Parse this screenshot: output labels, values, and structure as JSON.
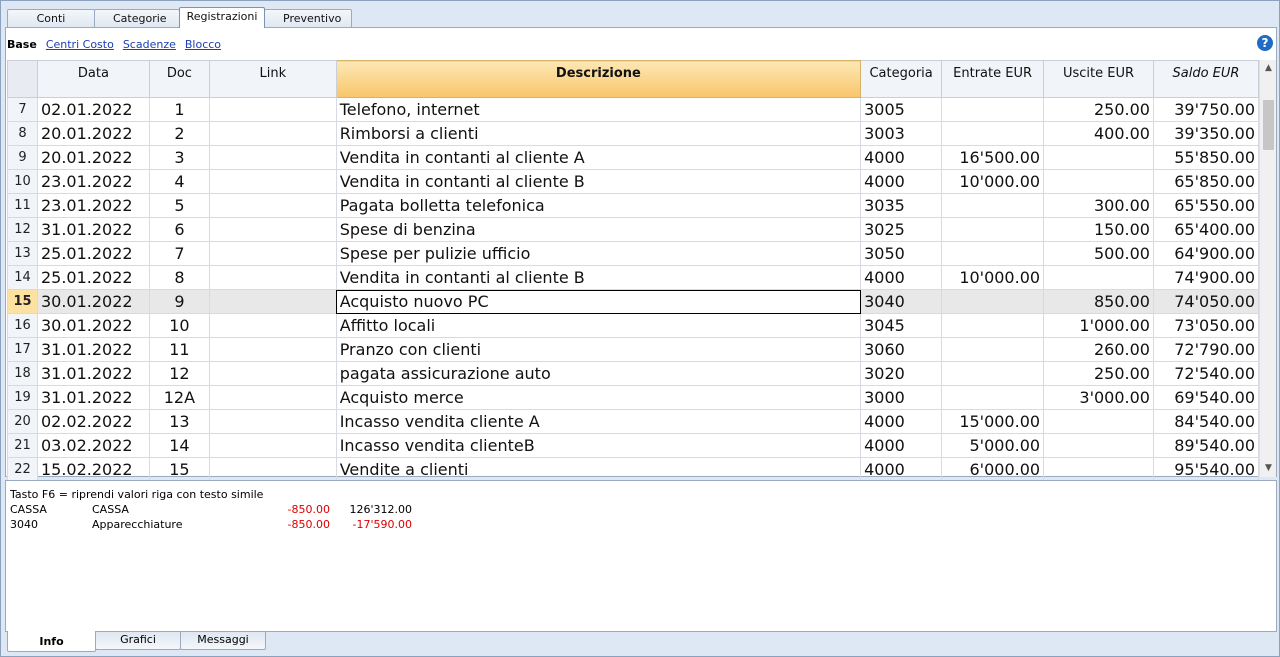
{
  "top_tabs": [
    "Conti",
    "Categorie",
    "Registrazioni",
    "Preventivo"
  ],
  "views": {
    "base": "Base",
    "links": [
      "Centri Costo",
      "Scadenze",
      "Blocco"
    ]
  },
  "help_icon": "?",
  "columns": [
    "Data",
    "Doc",
    "Link",
    "Descrizione",
    "Categoria",
    "Entrate EUR",
    "Uscite EUR",
    "Saldo EUR"
  ],
  "rows": [
    {
      "n": "7",
      "data": "02.01.2022",
      "doc": "1",
      "link": "",
      "desc": "Telefono, internet",
      "cat": "3005",
      "in": "",
      "out": "250.00",
      "saldo": "39'750.00"
    },
    {
      "n": "8",
      "data": "20.01.2022",
      "doc": "2",
      "link": "",
      "desc": "Rimborsi a clienti",
      "cat": "3003",
      "in": "",
      "out": "400.00",
      "saldo": "39'350.00"
    },
    {
      "n": "9",
      "data": "20.01.2022",
      "doc": "3",
      "link": "",
      "desc": "Vendita in contanti al cliente A",
      "cat": "4000",
      "in": "16'500.00",
      "out": "",
      "saldo": "55'850.00"
    },
    {
      "n": "10",
      "data": "23.01.2022",
      "doc": "4",
      "link": "",
      "desc": "Vendita in contanti al cliente B",
      "cat": "4000",
      "in": "10'000.00",
      "out": "",
      "saldo": "65'850.00"
    },
    {
      "n": "11",
      "data": "23.01.2022",
      "doc": "5",
      "link": "",
      "desc": "Pagata bolletta telefonica",
      "cat": "3035",
      "in": "",
      "out": "300.00",
      "saldo": "65'550.00"
    },
    {
      "n": "12",
      "data": "31.01.2022",
      "doc": "6",
      "link": "",
      "desc": "Spese di benzina",
      "cat": "3025",
      "in": "",
      "out": "150.00",
      "saldo": "65'400.00"
    },
    {
      "n": "13",
      "data": "25.01.2022",
      "doc": "7",
      "link": "",
      "desc": "Spese per pulizie ufficio",
      "cat": "3050",
      "in": "",
      "out": "500.00",
      "saldo": "64'900.00"
    },
    {
      "n": "14",
      "data": "25.01.2022",
      "doc": "8",
      "link": "",
      "desc": "Vendita in contanti al cliente B",
      "cat": "4000",
      "in": "10'000.00",
      "out": "",
      "saldo": "74'900.00"
    },
    {
      "n": "15",
      "data": "30.01.2022",
      "doc": "9",
      "link": "",
      "desc": "Acquisto nuovo PC",
      "cat": "3040",
      "in": "",
      "out": "850.00",
      "saldo": "74'050.00",
      "selected": true
    },
    {
      "n": "16",
      "data": "30.01.2022",
      "doc": "10",
      "link": "",
      "desc": "Affitto locali",
      "cat": "3045",
      "in": "",
      "out": "1'000.00",
      "saldo": "73'050.00"
    },
    {
      "n": "17",
      "data": "31.01.2022",
      "doc": "11",
      "link": "",
      "desc": "Pranzo con clienti",
      "cat": "3060",
      "in": "",
      "out": "260.00",
      "saldo": "72'790.00"
    },
    {
      "n": "18",
      "data": "31.01.2022",
      "doc": "12",
      "link": "",
      "desc": "pagata assicurazione auto",
      "cat": "3020",
      "in": "",
      "out": "250.00",
      "saldo": "72'540.00"
    },
    {
      "n": "19",
      "data": "31.01.2022",
      "doc": "12A",
      "link": "",
      "desc": "Acquisto merce",
      "cat": "3000",
      "in": "",
      "out": "3'000.00",
      "saldo": "69'540.00"
    },
    {
      "n": "20",
      "data": "02.02.2022",
      "doc": "13",
      "link": "",
      "desc": "Incasso vendita cliente A",
      "cat": "4000",
      "in": "15'000.00",
      "out": "",
      "saldo": "84'540.00"
    },
    {
      "n": "21",
      "data": "03.02.2022",
      "doc": "14",
      "link": "",
      "desc": "Incasso vendita clienteB",
      "cat": "4000",
      "in": "5'000.00",
      "out": "",
      "saldo": "89'540.00"
    },
    {
      "n": "22",
      "data": "15.02.2022",
      "doc": "15",
      "link": "",
      "desc": "Vendite a clienti",
      "cat": "4000",
      "in": "6'000.00",
      "out": "",
      "saldo": "95'540.00"
    }
  ],
  "info": {
    "hint": "Tasto F6 = riprendi valori riga con testo simile",
    "lines": [
      {
        "code": "CASSA",
        "name": "CASSA",
        "amount": "-850.00",
        "balance": "126'312.00",
        "balance_negative": false
      },
      {
        "code": "3040",
        "name": "Apparecchiature",
        "amount": "-850.00",
        "balance": "-17'590.00",
        "balance_negative": true
      }
    ]
  },
  "bottom_tabs": [
    "Info",
    "Grafici",
    "Messaggi"
  ]
}
